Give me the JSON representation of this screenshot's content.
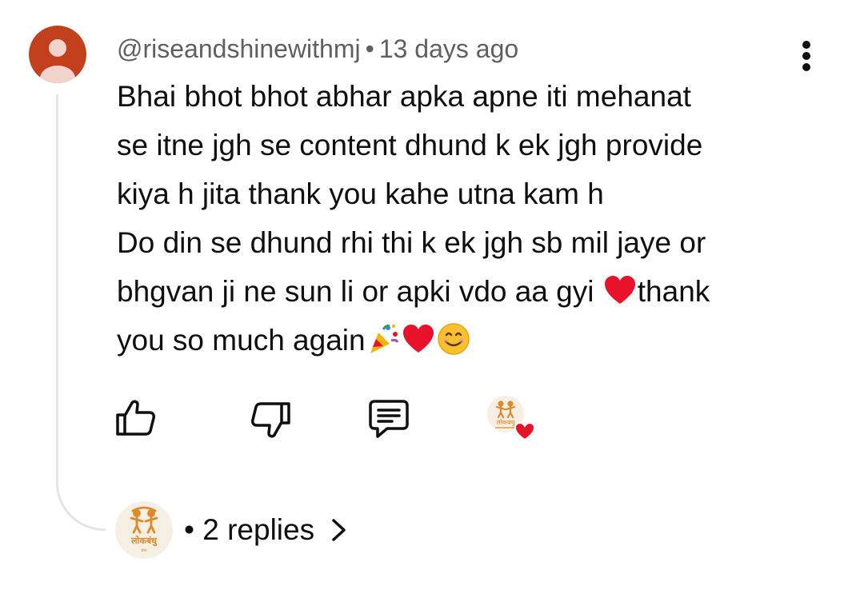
{
  "comment": {
    "author": "@riseandshinewithmj",
    "separator": "•",
    "time": "13 days ago",
    "lines": [
      "Bhai bhot bhot abhar apka apne iti mehanat",
      "se itne jgh se content dhund k ek jgh provide",
      "kiya h jita thank you kahe utna kam h",
      "Do din se dhund rhi thi k ek jgh sb mil jaye or",
      "bhgvan ji ne sun li or apki vdo aa gyi ",
      "thank",
      "you so much again"
    ]
  },
  "icons": {
    "avatar": "default-user-avatar",
    "more": "more-vert-icon",
    "like": "thumbs-up-icon",
    "dislike": "thumbs-down-icon",
    "reply": "comment-reply-icon",
    "creator_heart": "creator-heart-badge",
    "chevron": "chevron-right-icon"
  },
  "channel_logo": {
    "name": "लोकबंधु",
    "tagline": "ज्ञान"
  },
  "replies": {
    "label": "• 2 replies"
  },
  "colors": {
    "avatar_bg": "#c2401e",
    "text": "#0f0f0f",
    "meta_text": "#606060",
    "heart": "#e8132b",
    "thread_line": "#e5e5e5",
    "logo_orange": "#e0892a"
  }
}
